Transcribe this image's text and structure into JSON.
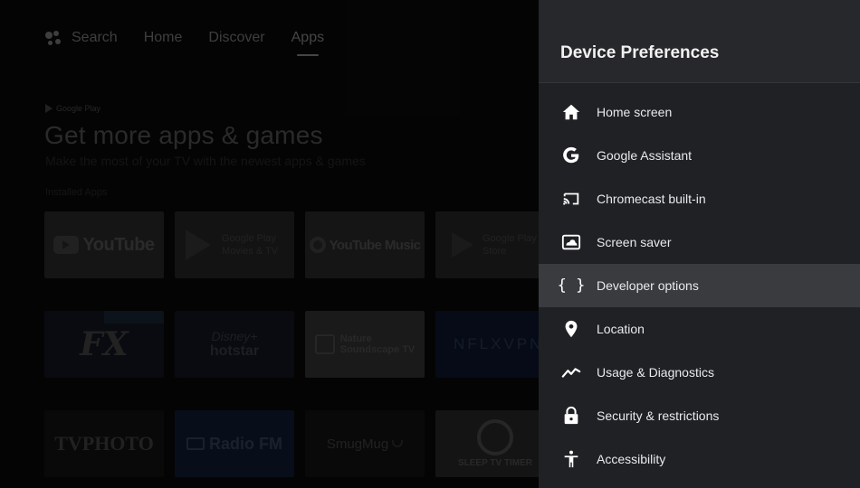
{
  "top_nav": {
    "items": [
      {
        "label": "Search"
      },
      {
        "label": "Home"
      },
      {
        "label": "Discover"
      },
      {
        "label": "Apps"
      }
    ],
    "active": "Apps"
  },
  "hero": {
    "brand": "Google Play",
    "title": "Get more apps & games",
    "subtitle": "Make the most of your TV with the newest apps & games"
  },
  "installed_label": "Installed Apps",
  "tiles": {
    "youtube": "YouTube",
    "play_movies_1": "Google Play",
    "play_movies_2": "Movies & TV",
    "youtube_music": "YouTube Music",
    "play_store_1": "Google Play",
    "play_store_2": "Store",
    "fx": "FX",
    "hotstar_1": "Disney+",
    "hotstar_2": "hotstar",
    "nature_1": "Nature",
    "nature_2": "Soundscape TV",
    "nflx": "NFLXVPN",
    "tvphoto": "TVPHOTO",
    "radiofm": "Radio FM",
    "smugmug": "SmugMug",
    "sleep": "SLEEP TV TIMER"
  },
  "panel": {
    "title": "Device Preferences",
    "items": [
      {
        "label": "Home screen",
        "icon": "home-icon"
      },
      {
        "label": "Google Assistant",
        "icon": "google-g-icon"
      },
      {
        "label": "Chromecast built-in",
        "icon": "cast-icon"
      },
      {
        "label": "Screen saver",
        "icon": "screensaver-icon"
      },
      {
        "label": "Developer options",
        "icon": "braces-icon"
      },
      {
        "label": "Location",
        "icon": "location-pin-icon"
      },
      {
        "label": "Usage & Diagnostics",
        "icon": "trending-line-icon"
      },
      {
        "label": "Security & restrictions",
        "icon": "lock-icon"
      },
      {
        "label": "Accessibility",
        "icon": "accessibility-icon"
      }
    ],
    "focused_index": 4
  },
  "colors": {
    "panel_bg": "#202124",
    "panel_header_bg": "#27282b",
    "focus_bg": "#3a3b3e",
    "text": "#e8eaed"
  }
}
